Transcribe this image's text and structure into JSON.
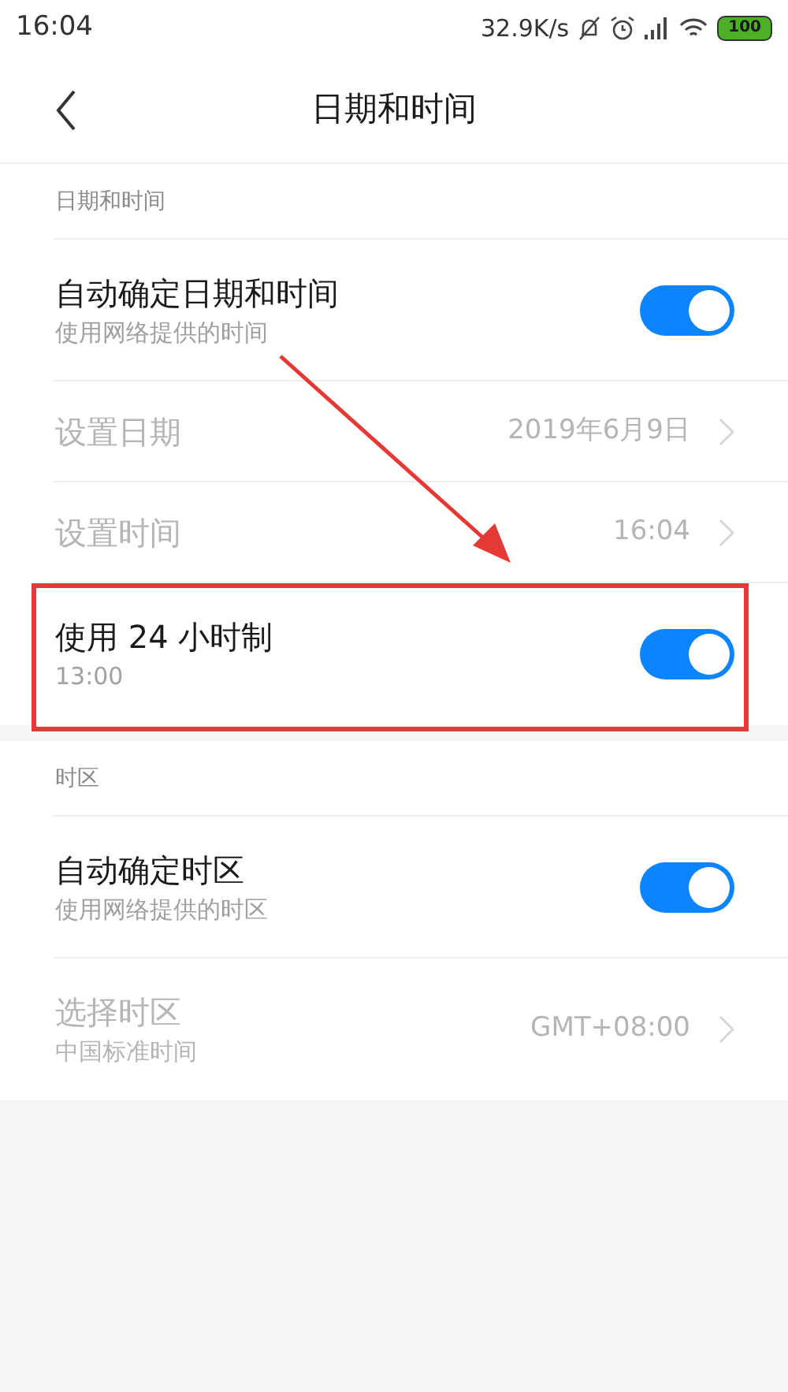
{
  "status_bar": {
    "time": "16:04",
    "speed": "32.9K/s",
    "battery": "100"
  },
  "header": {
    "title": "日期和时间"
  },
  "sections": [
    {
      "label": "日期和时间",
      "rows": [
        {
          "kind": "toggle",
          "title": "自动确定日期和时间",
          "subtitle": "使用网络提供的时间",
          "on": true,
          "disabled": false,
          "highlighted": false
        },
        {
          "kind": "link",
          "title": "设置日期",
          "value": "2019年6月9日",
          "disabled": true,
          "highlighted": false
        },
        {
          "kind": "link",
          "title": "设置时间",
          "value": "16:04",
          "disabled": true,
          "highlighted": false
        },
        {
          "kind": "toggle",
          "title": "使用 24 小时制",
          "subtitle": "13:00",
          "on": true,
          "disabled": false,
          "highlighted": true
        }
      ]
    },
    {
      "label": "时区",
      "rows": [
        {
          "kind": "toggle",
          "title": "自动确定时区",
          "subtitle": "使用网络提供的时区",
          "on": true,
          "disabled": false,
          "highlighted": false
        },
        {
          "kind": "link",
          "title": "选择时区",
          "subtitle": "中国标准时间",
          "value": "GMT+08:00",
          "disabled": true,
          "highlighted": false
        }
      ]
    }
  ]
}
